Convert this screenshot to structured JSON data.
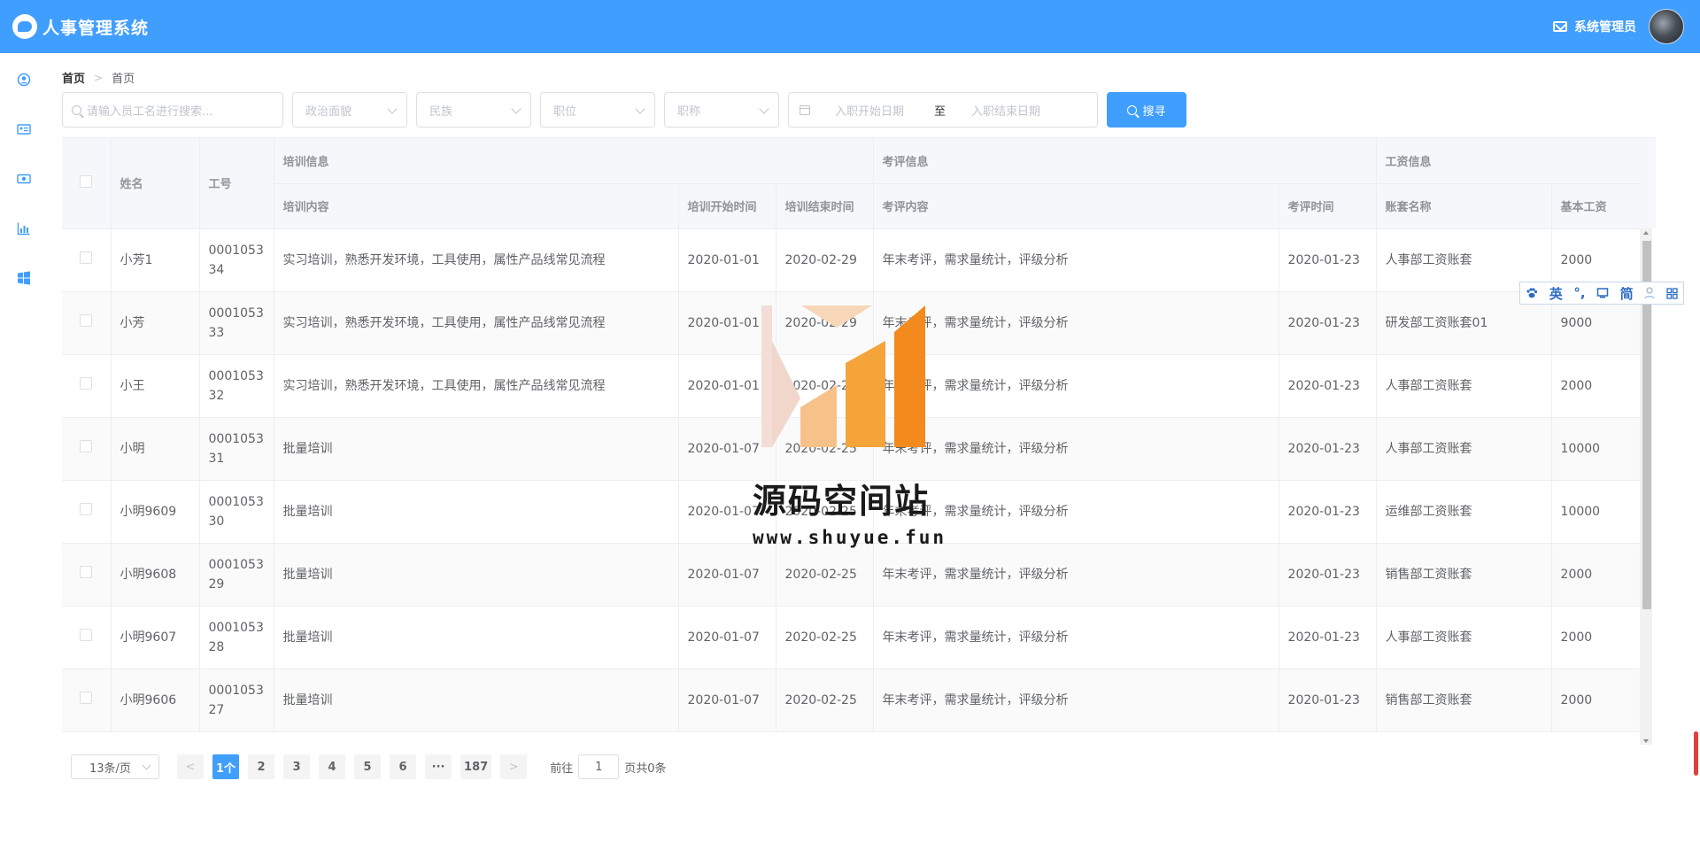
{
  "app": {
    "title": "人事管理系统",
    "admin_name": "系统管理员"
  },
  "breadcrumb": {
    "home": "首页",
    "current": "首页"
  },
  "filters": {
    "search_placeholder": "请输入员工名进行搜索...",
    "selects": [
      "政治面貌",
      "民族",
      "职位",
      "职称"
    ],
    "date_start_placeholder": "入职开始日期",
    "date_separator": "至",
    "date_end_placeholder": "入职结束日期",
    "search_button": "搜寻"
  },
  "table": {
    "group_headers": {
      "training": "培训信息",
      "appraisal": "考评信息",
      "salary": "工资信息"
    },
    "columns": {
      "name": "姓名",
      "code": "工号",
      "train_content": "培训内容",
      "train_start": "培训开始时间",
      "train_end": "培训结束时间",
      "appr_content": "考评内容",
      "appr_time": "考评时间",
      "salary_name": "账套名称",
      "base_salary": "基本工资"
    },
    "rows": [
      [
        "小芳1",
        "000105334",
        "实习培训，熟悉开发环境，工具使用，属性产品线常见流程",
        "2020-01-01",
        "2020-02-29",
        "年末考评，需求量统计，评级分析",
        "2020-01-23",
        "人事部工资账套",
        "2000"
      ],
      [
        "小芳",
        "000105333",
        "实习培训，熟悉开发环境，工具使用，属性产品线常见流程",
        "2020-01-01",
        "2020-02-29",
        "年末考评，需求量统计，评级分析",
        "2020-01-23",
        "研发部工资账套01",
        "9000"
      ],
      [
        "小王",
        "000105332",
        "实习培训，熟悉开发环境，工具使用，属性产品线常见流程",
        "2020-01-01",
        "2020-02-29",
        "年末考评，需求量统计，评级分析",
        "2020-01-23",
        "人事部工资账套",
        "2000"
      ],
      [
        "小明",
        "000105331",
        "批量培训",
        "2020-01-07",
        "2020-02-25",
        "年末考评，需求量统计，评级分析",
        "2020-01-23",
        "人事部工资账套",
        "10000"
      ],
      [
        "小明9609",
        "000105330",
        "批量培训",
        "2020-01-07",
        "2020-02-25",
        "年末考评，需求量统计，评级分析",
        "2020-01-23",
        "运维部工资账套",
        "10000"
      ],
      [
        "小明9608",
        "000105329",
        "批量培训",
        "2020-01-07",
        "2020-02-25",
        "年末考评，需求量统计，评级分析",
        "2020-01-23",
        "销售部工资账套",
        "2000"
      ],
      [
        "小明9607",
        "000105328",
        "批量培训",
        "2020-01-07",
        "2020-02-25",
        "年末考评，需求量统计，评级分析",
        "2020-01-23",
        "人事部工资账套",
        "2000"
      ],
      [
        "小明9606",
        "000105327",
        "批量培训",
        "2020-01-07",
        "2020-02-25",
        "年末考评，需求量统计，评级分析",
        "2020-01-23",
        "销售部工资账套",
        "2000"
      ]
    ]
  },
  "pagination": {
    "page_size": "13条/页",
    "pages": [
      "1个",
      "2",
      "3",
      "4",
      "5",
      "6",
      "···",
      "187"
    ],
    "goto_label": "前往",
    "goto_value": "1",
    "total_label": "页共0条"
  },
  "watermark": {
    "title": "源码空间站",
    "url": "www.shuyue.fun"
  },
  "ime": {
    "items": [
      "英",
      "°,",
      "简"
    ]
  },
  "sidebar": {
    "icons": [
      "user-circle-icon",
      "id-card-icon",
      "money-icon",
      "bar-chart-icon",
      "windows-icon"
    ]
  },
  "colors": {
    "primary": "#409eff",
    "header_bg": "#f5f7fa",
    "border": "#ebeef5"
  }
}
